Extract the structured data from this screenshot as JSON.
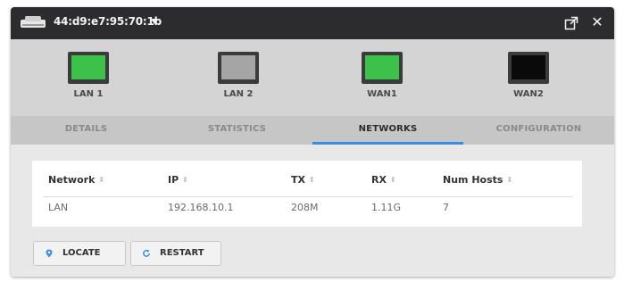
{
  "window": {
    "device_name": "44:d9:e7:95:70:1b",
    "device_icon": "device-icon",
    "popout_icon": "popout-icon",
    "close_glyph": "✕"
  },
  "ports": [
    {
      "label": "LAN 1",
      "status": "connected",
      "color": "#3cc24a"
    },
    {
      "label": "LAN 2",
      "status": "idle",
      "color": "#a5a5a5"
    },
    {
      "label": "WAN1",
      "status": "connected",
      "color": "#3cc24a"
    },
    {
      "label": "WAN2",
      "status": "disconnected",
      "color": "#0a0a0a"
    }
  ],
  "tabs": [
    {
      "label": "DETAILS",
      "active": false
    },
    {
      "label": "STATISTICS",
      "active": false
    },
    {
      "label": "NETWORKS",
      "active": true
    },
    {
      "label": "CONFIGURATION",
      "active": false
    }
  ],
  "table": {
    "columns": [
      "Network",
      "IP",
      "TX",
      "RX",
      "Num Hosts"
    ],
    "sort_glyph": "⇕",
    "rows": [
      [
        "LAN",
        "192.168.10.1",
        "208M",
        "1.11G",
        "7"
      ]
    ]
  },
  "actions": {
    "locate_label": "LOCATE",
    "restart_label": "RESTART"
  },
  "colors": {
    "accent": "#3a8edb",
    "titlebar": "#2c2c2e",
    "port_connected": "#3cc24a"
  }
}
